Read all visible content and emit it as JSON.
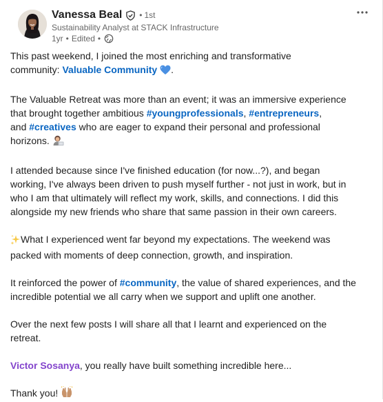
{
  "author": {
    "name": "Vanessa Beal",
    "degree": "1st",
    "headline": "Sustainability Analyst at STACK Infrastructure",
    "age": "1yr",
    "edited": "Edited"
  },
  "post": {
    "p1_a": "This past weekend, I joined the most enriching and transformative",
    "p1_b": "community: ",
    "p1_link": "Valuable Community",
    "p1_end": ".",
    "p2_a": "The Valuable Retreat was more than an event; it was an immersive experience",
    "p2_b": "that brought together ambitious ",
    "tag_youngprofessionals": "#youngprofessionals",
    "comma1": ", ",
    "tag_entrepreneurs": "#entrepreneurs",
    "comma2": ",",
    "p2_c": "and ",
    "tag_creatives": "#creatives",
    "p2_d": " who are eager to expand their personal and professional",
    "p2_e": "horizons. ",
    "p3_a": "I attended because since I've finished education (for now...?), and began",
    "p3_b": "working, I've always been driven to push myself further - not just in work, but in",
    "p3_c": "who I am that ultimately will reflect my work, skills, and connections. I did this",
    "p3_d": "alongside my new friends who share that same passion in their own careers.",
    "p4_a": "What I experienced went far beyond my expectations. The weekend was",
    "p4_b": "packed with moments of deep connection, growth, and inspiration.",
    "p5_a": "It reinforced the power of ",
    "tag_community": "#community",
    "p5_b": ", the value of shared experiences, and the",
    "p5_c": "incredible potential we all carry when we support and uplift one another.",
    "p6_a": "Over the next few posts I will share all that I learnt and experienced on the",
    "p6_b": "retreat.",
    "mention": "Victor Sosanya",
    "p7_rest": ", you really have built something incredible here...",
    "p8": "Thank you! "
  },
  "icons": {
    "verified": "verified-shield-icon",
    "globe": "globe-icon",
    "more": "more-options-icon",
    "heart": "blue-heart-emoji",
    "woman": "woman-technologist-emoji",
    "sparkles": "sparkles-emoji",
    "hands": "raising-hands-emoji"
  },
  "colors": {
    "link": "#0a66c2",
    "mention": "#8344cc",
    "text": "#1f1f1f",
    "muted": "#666666"
  }
}
